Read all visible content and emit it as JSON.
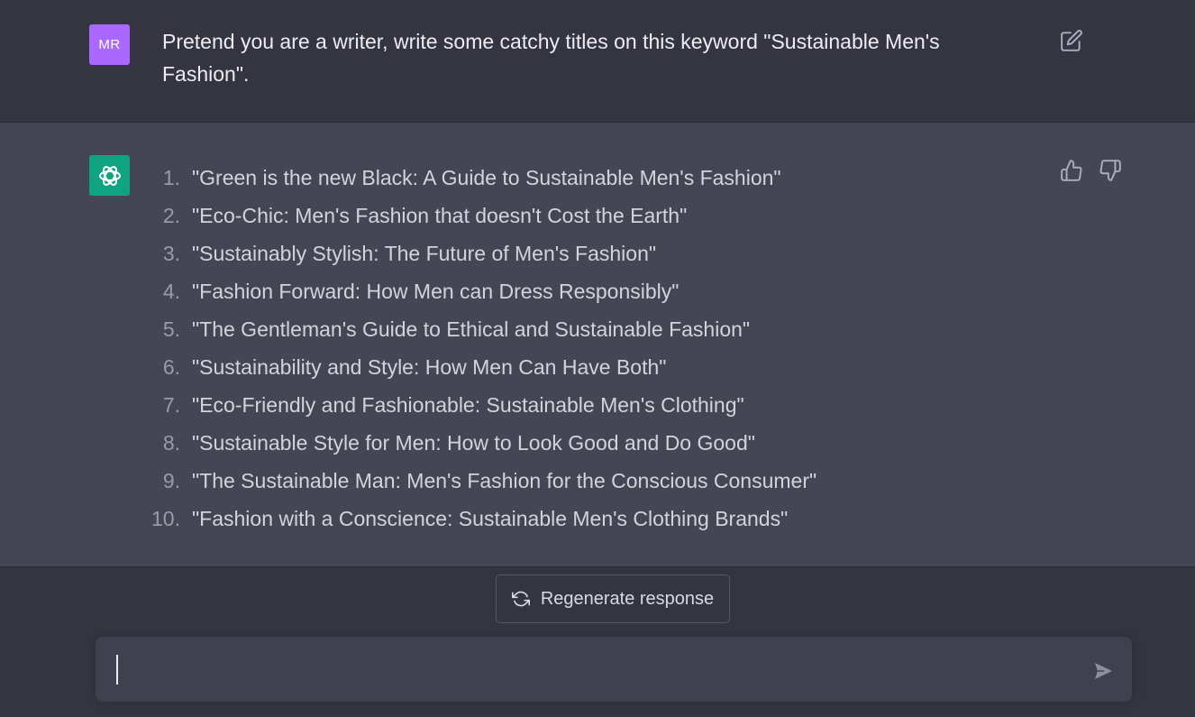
{
  "user_message": {
    "avatar_initials": "MR",
    "text": "Pretend you are a writer, write some catchy titles on this keyword \"Sustainable Men's Fashion\"."
  },
  "assistant_message": {
    "items": [
      {
        "num": "1.",
        "text": "\"Green is the new Black: A Guide to Sustainable Men's Fashion\""
      },
      {
        "num": "2.",
        "text": "\"Eco-Chic: Men's Fashion that doesn't Cost the Earth\""
      },
      {
        "num": "3.",
        "text": "\"Sustainably Stylish: The Future of Men's Fashion\""
      },
      {
        "num": "4.",
        "text": "\"Fashion Forward: How Men can Dress Responsibly\""
      },
      {
        "num": "5.",
        "text": "\"The Gentleman's Guide to Ethical and Sustainable Fashion\""
      },
      {
        "num": "6.",
        "text": "\"Sustainability and Style: How Men Can Have Both\""
      },
      {
        "num": "7.",
        "text": "\"Eco-Friendly and Fashionable: Sustainable Men's Clothing\""
      },
      {
        "num": "8.",
        "text": "\"Sustainable Style for Men: How to Look Good and Do Good\""
      },
      {
        "num": "9.",
        "text": "\"The Sustainable Man: Men's Fashion for the Conscious Consumer\""
      },
      {
        "num": "10.",
        "text": "\"Fashion with a Conscience: Sustainable Men's Clothing Brands\""
      }
    ]
  },
  "controls": {
    "regenerate_label": "Regenerate response",
    "input_value": ""
  },
  "icons": {
    "edit": "edit-icon",
    "thumbs_up": "thumbs-up-icon",
    "thumbs_down": "thumbs-down-icon",
    "regenerate": "refresh-icon",
    "send": "send-icon",
    "bot_logo": "openai-logo-icon"
  },
  "colors": {
    "user_avatar": "#ab68ff",
    "bot_avatar": "#10a37f",
    "user_bg": "#343541",
    "assistant_bg": "#444654"
  }
}
